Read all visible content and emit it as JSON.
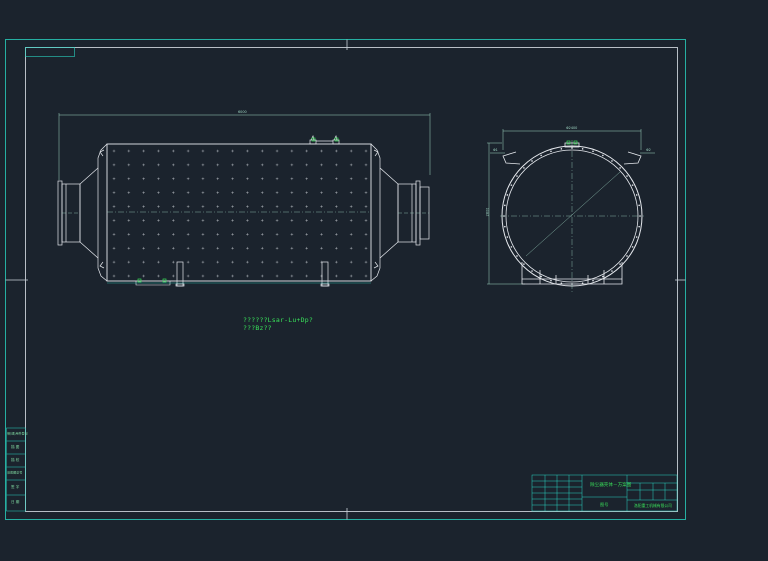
{
  "drawing": {
    "notes": [
      "??????Lsar-Lu+Dp?",
      "???Bz??"
    ],
    "dims": {
      "length": "6000",
      "width": "Φ2400",
      "height": "2800",
      "left_tag": "Φ1",
      "right_tag": "Φ2"
    },
    "title_block": {
      "drawing_title": "除尘器壳体－方案图",
      "drawing_no": "图号",
      "company": "洛阳重工机械有限公司"
    },
    "left_strip": [
      "借(通)用件登记",
      "描 图",
      "描 校",
      "旧底图总号",
      "签 字",
      "日 期"
    ]
  },
  "colors": {
    "background": "#1b232d",
    "frame": "#c9d0d8",
    "drawing_line": "#e6e9ee",
    "cad_green": "#39e05a",
    "cad_cyan": "#2ad3c0"
  }
}
